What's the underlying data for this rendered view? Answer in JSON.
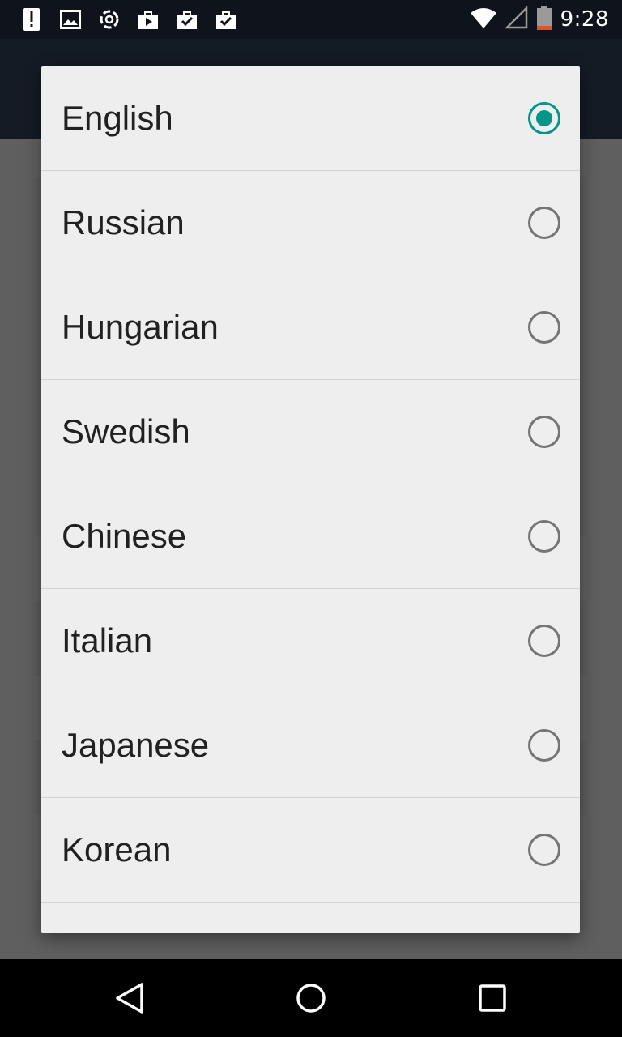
{
  "status_bar": {
    "time": "9:28",
    "icons": [
      "alert-icon",
      "image-icon",
      "sync-icon",
      "play-store-icon",
      "shopping-bag-check-icon",
      "shopping-bag-check-icon",
      "wifi-icon",
      "signal-icon",
      "battery-icon"
    ]
  },
  "dialog": {
    "options": [
      {
        "label": "English",
        "checked": true
      },
      {
        "label": "Russian",
        "checked": false
      },
      {
        "label": "Hungarian",
        "checked": false
      },
      {
        "label": "Swedish",
        "checked": false
      },
      {
        "label": "Chinese",
        "checked": false
      },
      {
        "label": "Italian",
        "checked": false
      },
      {
        "label": "Japanese",
        "checked": false
      },
      {
        "label": "Korean",
        "checked": false
      }
    ]
  },
  "colors": {
    "accent": "#009688",
    "status_bar": "#0f141c",
    "app_bar": "#151b25",
    "dialog_bg": "#eeeeee",
    "scrim": "#5f5f5f"
  },
  "nav_bar": {
    "icons": [
      "back-icon",
      "home-icon",
      "recents-icon"
    ]
  }
}
